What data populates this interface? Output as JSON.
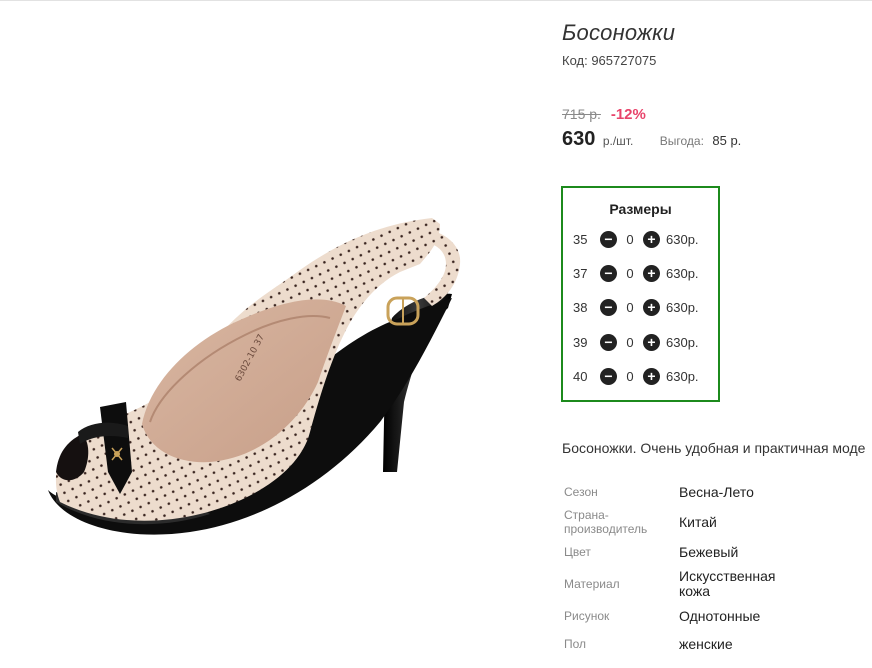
{
  "product": {
    "title": "Босоножки",
    "code": "Код: 965727075",
    "old_price": "715 р.",
    "discount": "-12%",
    "price": "630",
    "unit": "р./шт.",
    "saving_label": "Выгода:",
    "saving_value": "85 р."
  },
  "sizes": {
    "title": "Размеры",
    "rows": [
      {
        "size": "35",
        "qty": "0",
        "price": "630р."
      },
      {
        "size": "37",
        "qty": "0",
        "price": "630р."
      },
      {
        "size": "38",
        "qty": "0",
        "price": "630р."
      },
      {
        "size": "39",
        "qty": "0",
        "price": "630р."
      },
      {
        "size": "40",
        "qty": "0",
        "price": "630р."
      }
    ],
    "minus_symbol": "−",
    "plus_symbol": "+"
  },
  "description": "Босоножки. Очень удобная и практичная моде",
  "attributes": [
    {
      "label": "Сезон",
      "value": "Весна-Лето"
    },
    {
      "label": "Страна-\nпроизводитель",
      "value": "Китай"
    },
    {
      "label": "Цвет",
      "value": "Бежевый"
    },
    {
      "label": "Материал",
      "value": "Искусственная\nкожа"
    },
    {
      "label": "Рисунок",
      "value": "Однотонные"
    },
    {
      "label": "Пол",
      "value": "женские"
    }
  ],
  "image": {
    "alt_icon": "sandal-product-photo",
    "insole_text": "6302-10  37"
  },
  "colors": {
    "sizes_border": "#1c8a1c",
    "discount": "#e8446b",
    "shoe_body": "#eddccd",
    "shoe_black": "#111111",
    "buckle": "#c9a25a"
  }
}
